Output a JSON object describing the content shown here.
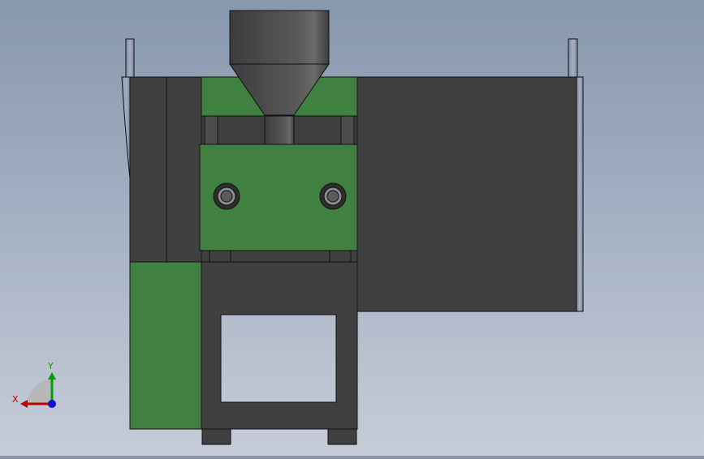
{
  "viewport": {
    "background_top": "#8797ad",
    "background_bottom": "#c6cdd9"
  },
  "model": {
    "colors": {
      "dark_gray": "#404040",
      "green": "#408040",
      "outline": "#101010",
      "hole_fill": "#a8b2c4",
      "rail": "#8a96aa"
    }
  },
  "triad": {
    "x_label": "X",
    "y_label": "Y",
    "x_color": "#c00000",
    "y_color": "#00a000",
    "z_color": "#1010d0"
  }
}
